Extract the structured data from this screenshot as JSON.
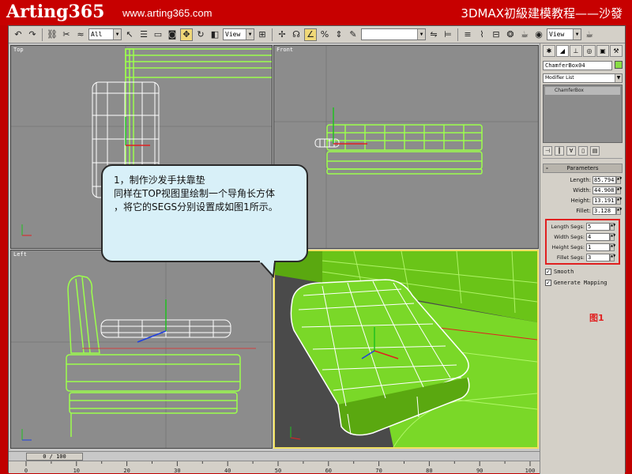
{
  "banner": {
    "brand": "Arting365",
    "site": "www.arting365.com",
    "lesson": "3DMAX初級建模教程——沙發"
  },
  "toolbar": {
    "selection_filter": "All",
    "ref_coord": "View",
    "named_selection": "",
    "render_view": "View",
    "icons": [
      "undo-icon",
      "redo-icon",
      "link-icon",
      "unlink-icon",
      "bind-space-warp-icon",
      "select-icon",
      "select-by-name-icon",
      "rect-region-icon",
      "window-crossing-icon",
      "move-icon",
      "rotate-icon",
      "scale-icon",
      "pivot-icon",
      "snap-icon",
      "angle-snap-icon",
      "percent-snap-icon",
      "spinner-snap-icon",
      "mirror-icon",
      "align-icon",
      "layer-icon",
      "curve-editor-icon",
      "schematic-icon",
      "material-editor-icon",
      "render-scene-icon",
      "quick-render-icon"
    ]
  },
  "viewports": {
    "top": "Top",
    "front": "Front",
    "left": "Left",
    "perspective": ""
  },
  "callout": {
    "line1": "1，制作沙发手扶靠垫",
    "line2": "同样在TOP视图里绘制一个导角长方体",
    "line3": "，将它的SEGS分别设置成如图1所示。"
  },
  "command_panel": {
    "object_name": "ChamferBox04",
    "object_color": "#88dd44",
    "modifier_list": "Modifier List",
    "stack_item": "ChamferBox",
    "rollout_title": "Parameters",
    "params": [
      {
        "label": "Length:",
        "value": "85.794"
      },
      {
        "label": "Width:",
        "value": "44.908"
      },
      {
        "label": "Height:",
        "value": "13.191"
      },
      {
        "label": "Fillet:",
        "value": "3.128"
      }
    ],
    "segs": [
      {
        "label": "Length Segs:",
        "value": "5"
      },
      {
        "label": "Width Segs:",
        "value": "4"
      },
      {
        "label": "Height Segs:",
        "value": "1"
      },
      {
        "label": "Fillet Segs:",
        "value": "3"
      }
    ],
    "smooth": "Smooth",
    "gen_mapping": "Generate Mapping",
    "figure_label": "图1"
  },
  "timeline": {
    "slider": "0 / 100",
    "ticks": [
      "0",
      "10",
      "20",
      "30",
      "40",
      "50",
      "60",
      "70",
      "80",
      "90",
      "100"
    ]
  }
}
